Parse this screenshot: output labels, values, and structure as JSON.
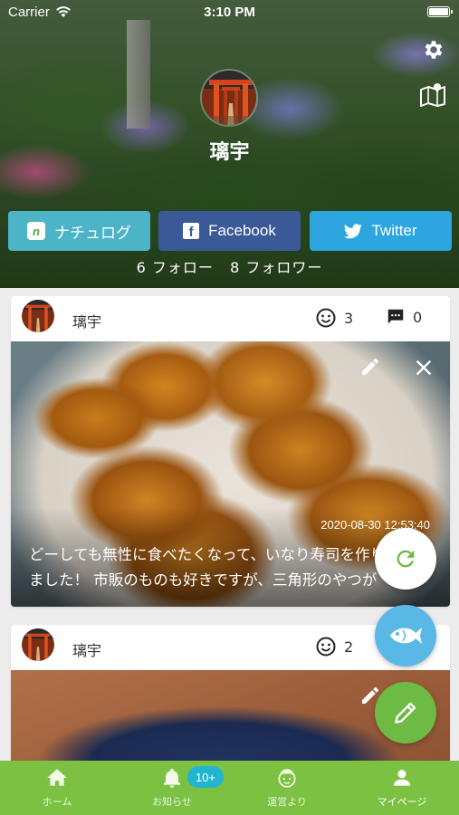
{
  "status_bar": {
    "carrier": "Carrier",
    "time": "3:10 PM"
  },
  "profile": {
    "name": "璃宇",
    "follow_count": "6 フォロー",
    "follower_count": "8 フォロワー"
  },
  "sns_buttons": {
    "nachulog": "ナチュログ",
    "facebook": "Facebook",
    "twitter": "Twitter"
  },
  "posts": [
    {
      "user": "璃宇",
      "likes": "3",
      "comments": "0",
      "date": "2020-08-30 12:53:40",
      "text_line1": "どーしても無性に食べたくなって、いなり寿司を作り",
      "text_line2": "ました！ 市販のものも好きですが、三角形のやつが"
    },
    {
      "user": "璃宇",
      "likes": "2"
    }
  ],
  "tabs": [
    {
      "label": "ホーム",
      "icon": "home-icon"
    },
    {
      "label": "お知らせ",
      "icon": "bell-icon"
    },
    {
      "label": "運営より",
      "icon": "staff-face-icon"
    },
    {
      "label": "マイページ",
      "icon": "person-icon"
    }
  ],
  "notification_badge": "10+",
  "colors": {
    "nachulog": "#4db4c8",
    "facebook": "#3b5997",
    "twitter": "#2da6e0",
    "tabbar": "#7cc142",
    "fab_fish": "#59b8e6",
    "fab_edit": "#6dba45",
    "badge": "#21b6d0"
  }
}
